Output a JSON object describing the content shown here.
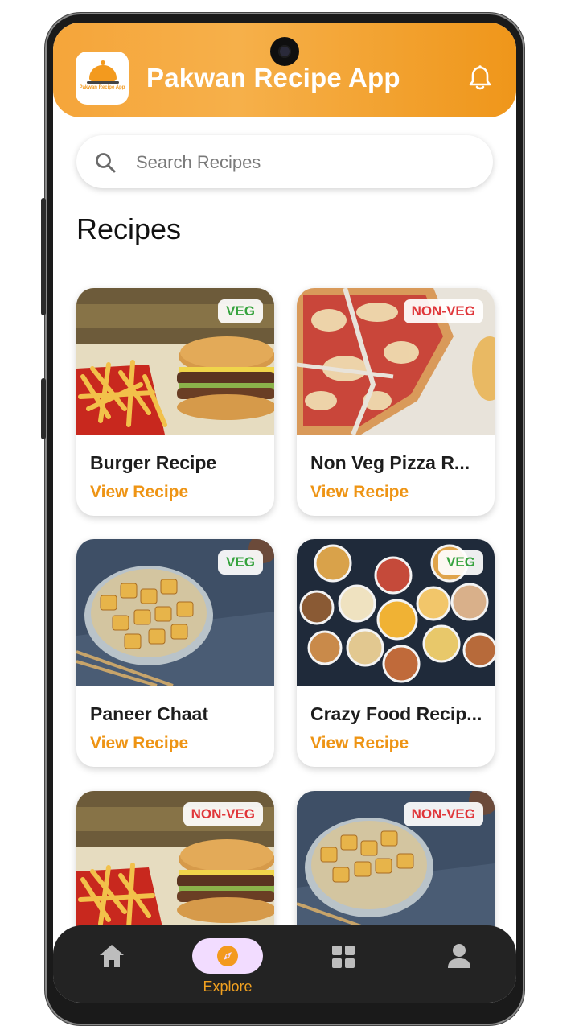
{
  "app": {
    "title": "Pakwan Recipe App",
    "logo_text": "Pakwan Recipe App",
    "accent": "#f39a1e"
  },
  "search": {
    "placeholder": "Search Recipes",
    "value": ""
  },
  "section": {
    "title": "Recipes"
  },
  "recipes": [
    {
      "title": "Burger Recipe",
      "tag": "VEG",
      "link": "View Recipe",
      "image": "burger-fries"
    },
    {
      "title": "Non Veg Pizza R...",
      "tag": "NON-VEG",
      "link": "View Recipe",
      "image": "pizza"
    },
    {
      "title": "Paneer Chaat",
      "tag": "VEG",
      "link": "View Recipe",
      "image": "paneer-bowl"
    },
    {
      "title": "Crazy Food Recip...",
      "tag": "VEG",
      "link": "View Recipe",
      "image": "snack-bowls"
    },
    {
      "title": "",
      "tag": "NON-VEG",
      "link": "",
      "image": "burger-fries"
    },
    {
      "title": "",
      "tag": "NON-VEG",
      "link": "",
      "image": "paneer-bowl"
    }
  ],
  "nav": {
    "items": [
      {
        "icon": "home-icon",
        "label": ""
      },
      {
        "icon": "compass-icon",
        "label": "Explore",
        "active": true
      },
      {
        "icon": "grid-icon",
        "label": ""
      },
      {
        "icon": "person-icon",
        "label": ""
      }
    ]
  },
  "colors": {
    "veg": "#36a33e",
    "nonveg": "#e0363a",
    "nav_bg": "#232323",
    "nav_active_pill": "#f2dcff"
  }
}
